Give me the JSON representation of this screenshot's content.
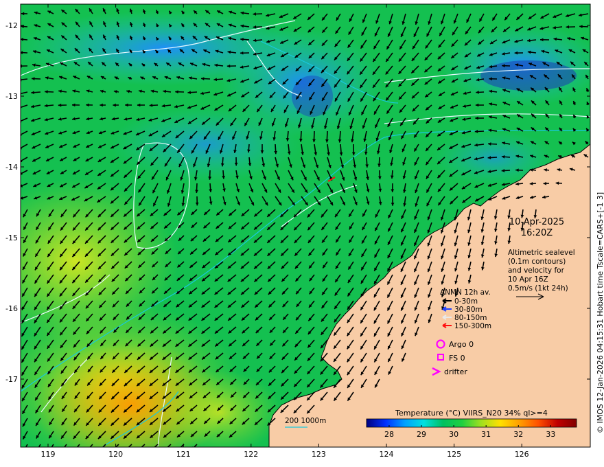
{
  "map": {
    "x_ticks": [
      "119",
      "120",
      "121",
      "122",
      "123",
      "124",
      "125",
      "126"
    ],
    "y_ticks": [
      "-12",
      "-13",
      "-14",
      "-15",
      "-16",
      "-17"
    ],
    "colors": {
      "land": "#f8cca6",
      "coast": "#000000",
      "contour": "#e8f6ff",
      "isobath": "#18c8e0",
      "arrow": "#000000"
    }
  },
  "info": {
    "date": "10-Apr-2025",
    "time": "16:20Z",
    "description": [
      "Altimetric sealevel",
      "(0.1m contours)",
      "and velocity for",
      "10 Apr 16Z",
      "0.5m/s (1kt 24h)"
    ]
  },
  "legend": {
    "title": "ANMN 12h av.",
    "depths": [
      {
        "label": "0-30m",
        "color": "#000000"
      },
      {
        "label": "30-80m",
        "color": "#1f3fff"
      },
      {
        "label": "80-150m",
        "color": "#e8e8e8"
      },
      {
        "label": "150-300m",
        "color": "#ff1010"
      }
    ],
    "markers": [
      {
        "label": "Argo 0",
        "icon": "circle-icon",
        "color": "#ff00ff"
      },
      {
        "label": "FS 0",
        "icon": "square-icon",
        "color": "#ff00ff"
      },
      {
        "label": "drifter",
        "icon": "chevron-icon",
        "color": "#ff00ff"
      }
    ]
  },
  "isobath_label": "200  1000m",
  "colorbar": {
    "title": "Temperature (°C) VIIRS_N20 34% ql>=4",
    "ticks": [
      "28",
      "29",
      "30",
      "31",
      "32",
      "33"
    ],
    "range": [
      27.3,
      33.8
    ],
    "colors": [
      "#00007f",
      "#0030ff",
      "#00a0ff",
      "#00e0e0",
      "#00c060",
      "#20d040",
      "#a0e020",
      "#ffe000",
      "#ffa000",
      "#ff5000",
      "#c00000",
      "#800000"
    ]
  },
  "side_text": "© IMOS 12-Jan-2026 04:15:31 Hobart time Tscale=CARS+[-1 3]"
}
